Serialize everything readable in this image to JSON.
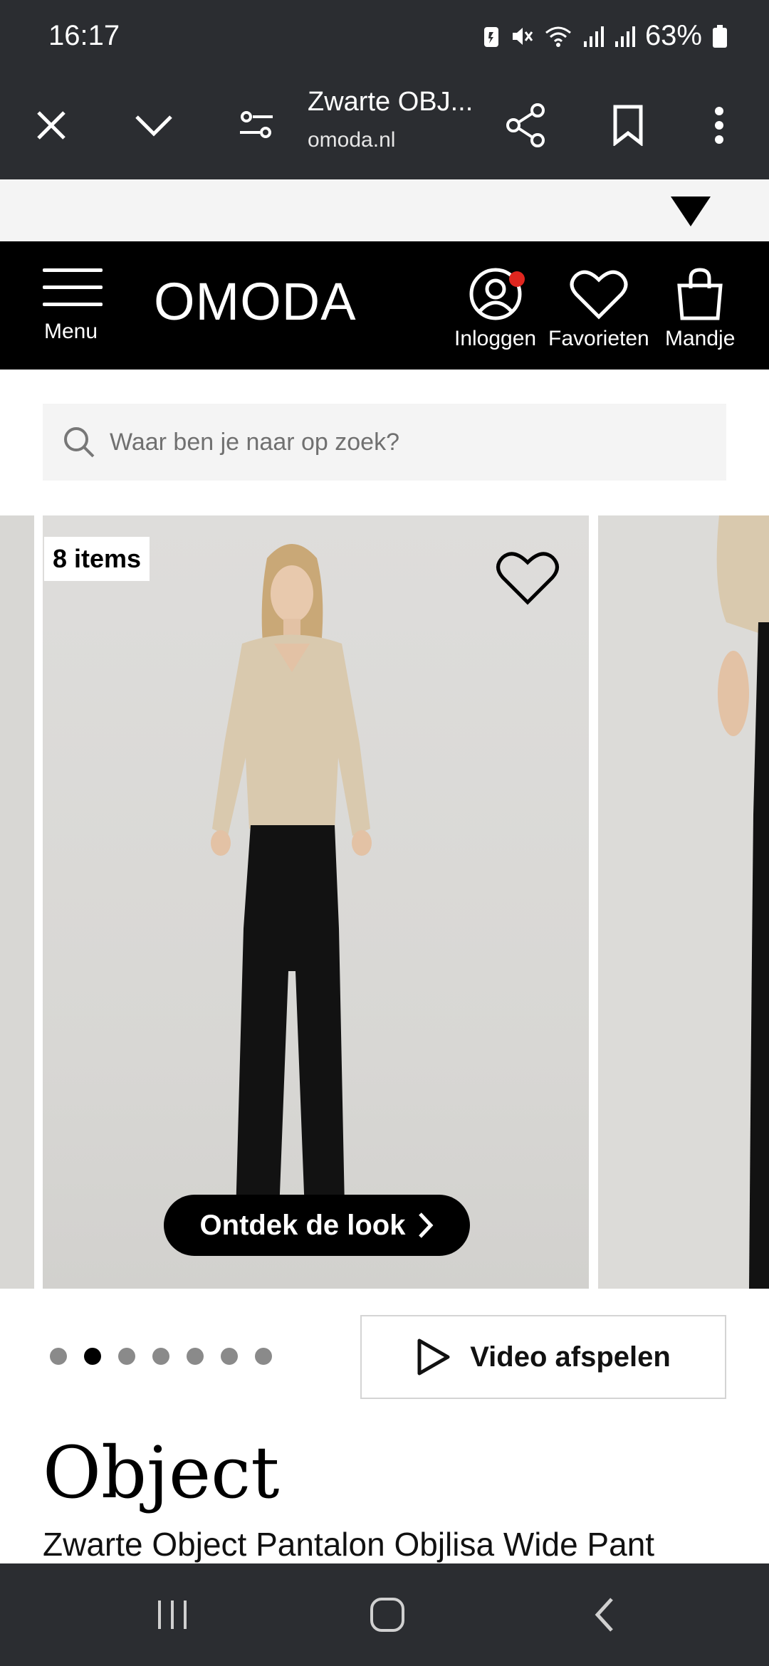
{
  "status_bar": {
    "time": "16:17",
    "battery_percent": "63%",
    "icons": [
      "battery-saver-icon",
      "mute-icon",
      "wifi-icon",
      "signal-icon",
      "signal-icon",
      "battery-icon"
    ]
  },
  "browser": {
    "page_title": "Zwarte OBJ...",
    "url": "omoda.nl",
    "icons": [
      "close-icon",
      "chevron-down-icon",
      "site-settings-icon",
      "share-icon",
      "bookmark-icon",
      "more-icon"
    ]
  },
  "site_header": {
    "menu_label": "Menu",
    "logo": "OMODA",
    "login_label": "Inloggen",
    "favorites_label": "Favorieten",
    "cart_label": "Mandje"
  },
  "search": {
    "placeholder": "Waar ben je naar op zoek?"
  },
  "carousel": {
    "items_badge": "8 items",
    "cta_label": "Ontdek de look",
    "slide_count": 7,
    "active_index": 1
  },
  "video": {
    "label": "Video afspelen"
  },
  "product": {
    "brand": "Object",
    "name": "Zwarte Object Pantalon Objlisa Wide Pant"
  },
  "colors": {
    "chrome": "#2b2d31",
    "header": "#000000",
    "notification": "#e0261f",
    "search_bg": "#f4f4f4",
    "slide_bg": "#dcdbd8"
  }
}
